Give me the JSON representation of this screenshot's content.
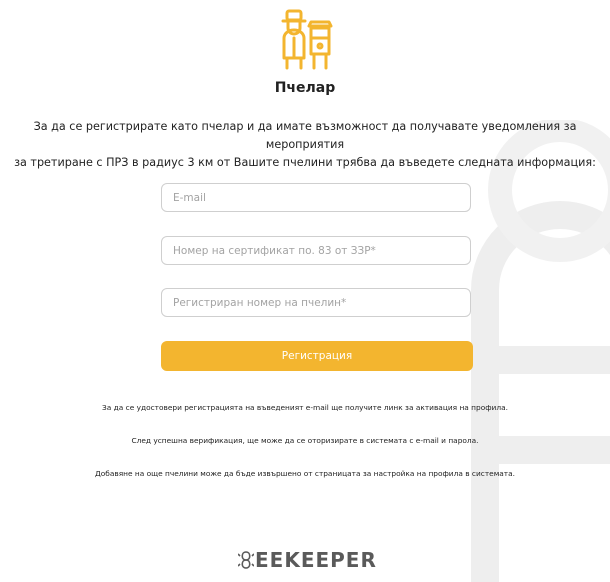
{
  "header": {
    "role_title": "Пчелар",
    "intro_line1": "За да се регистрирате като пчелар и да имате възможност да получавате уведомления за мероприятия",
    "intro_line2": "за третиране с ПРЗ в радиус 3 км от Вашите пчелини трябва да въведете следната информация:"
  },
  "form": {
    "email_placeholder": "E-mail",
    "certificate_placeholder": "Номер на сертификат по. 83 от ЗЗР*",
    "apiary_placeholder": "Регистриран номер на пчелин*",
    "register_label": "Регистрация"
  },
  "notes": [
    "За да се удостовери регистрацията на въведеният e-mail ще получите линк за активация на профила.",
    "След успешна верификация, ще може да се оторизирате в системата с e-mail и парола.",
    "Добавяне на още пчелини може да бъде извършено от страницата за настройка на профила в системата."
  ],
  "footer": {
    "brand_text": "EEKEEPER"
  },
  "icons": {
    "role": "beekeeper-hive-icon",
    "brand": "bee-logo-icon"
  },
  "colors": {
    "accent": "#f3b52f",
    "watermark": "#eeeeee",
    "text": "#222222",
    "brand_text": "#5a5a5a"
  }
}
